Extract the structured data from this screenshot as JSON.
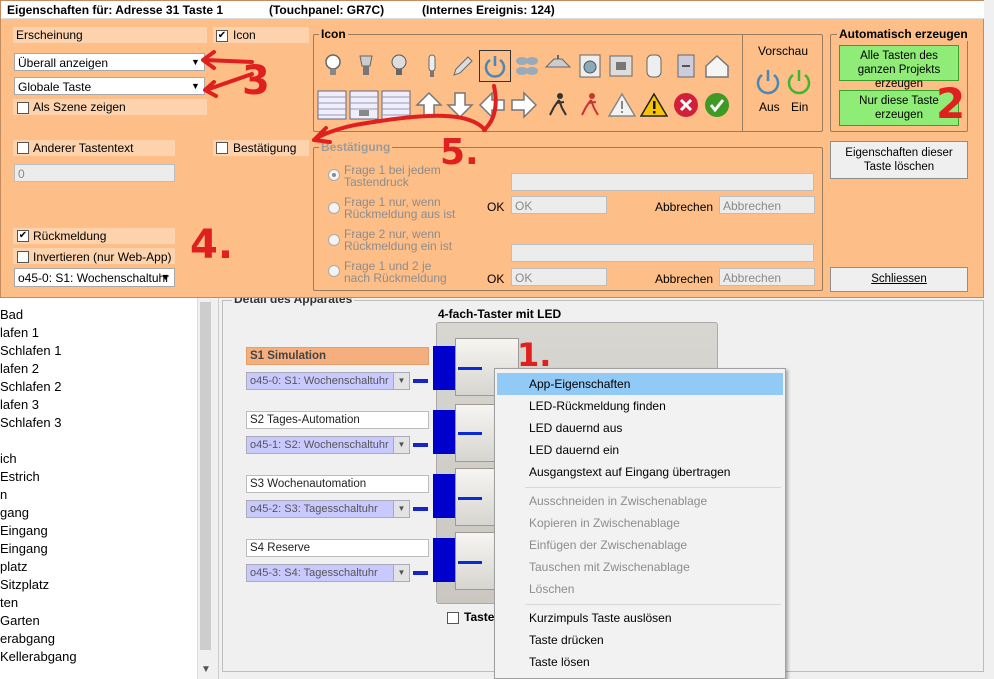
{
  "dialog": {
    "title_left": "Eigenschaften für: Adresse  31  Taste 1",
    "title_mid": "(Touchpanel: GR7C)",
    "title_right": "(Internes Ereignis: 124)",
    "erscheinung_label": "Erscheinung",
    "erscheinung_value": "Überall anzeigen",
    "taste_type_value": "Globale Taste",
    "als_szene_label": "Als Szene zeigen",
    "als_szene_checked": false,
    "icon_chk_label": "Icon",
    "icon_chk_checked": true,
    "anderer_tastentext_label": "Anderer Tastentext",
    "anderer_tastentext_checked": false,
    "anderer_tastentext_value": "0",
    "bestaetigung_chk_label": "Bestätigung",
    "bestaetigung_chk_checked": false,
    "rueckmeldung_label": "Rückmeldung",
    "rueckmeldung_checked": true,
    "invertieren_label": "Invertieren (nur Web-App)",
    "invertieren_checked": false,
    "rueckmeldung_value": "o45-0: S1: Wochenschaltuhr",
    "icon_group_title": "Icon",
    "vorschau_label": "Vorschau",
    "vorschau_aus": "Aus",
    "vorschau_ein": "Ein",
    "auto_group_title": "Automatisch erzeugen",
    "btn_alle_tasten": "Alle Tasten des ganzen Projekts erzeugen",
    "btn_nur_diese": "Nur diese Taste erzeugen",
    "btn_loeschen": "Eigenschaften dieser Taste löschen",
    "btn_schliessen": "Schliessen",
    "bestaetigung_group_title": "Bestätigung",
    "frage1": "Frage 1 bei jedem Tastendruck",
    "frage1_aus": "Frage 1 nur, wenn Rückmeldung aus ist",
    "frage2_ein": "Frage 2 nur, wenn Rückmeldung ein ist",
    "frage12": "Frage 1 und 2 je nach Rückmeldung",
    "ok_label": "OK",
    "ok_value": "OK",
    "abbrechen_label": "Abbrechen",
    "abbrechen_value": "Abbrechen",
    "icons_row1": [
      "bulb-icon",
      "spotlight-icon",
      "bulb-outline-icon",
      "tube-icon",
      "pen-icon",
      "power-icon",
      "fan-icon",
      "ceiling-lamp-icon",
      "washing-machine-icon",
      "coffee-machine-icon",
      "boiler-icon",
      "cabinet-icon",
      "house-icon"
    ],
    "icons_row2": [
      "blind-1-icon",
      "blind-2-icon",
      "blind-3-icon",
      "arrow-up-icon",
      "arrow-down-icon",
      "arrow-left-icon",
      "arrow-right-icon",
      "runner-icon",
      "runner-red-icon",
      "warning-outline-icon",
      "warning-yellow-icon",
      "error-red-icon",
      "ok-green-icon"
    ]
  },
  "rooms": [
    "Bad",
    "lafen 1",
    "Schlafen 1",
    "lafen 2",
    "Schlafen 2",
    "lafen 3",
    "Schlafen 3",
    "",
    "ich",
    "Estrich",
    "n",
    "gang",
    "Eingang",
    "Eingang",
    "platz",
    "Sitzplatz",
    "ten",
    "Garten",
    "erabgang",
    "Kellerabgang"
  ],
  "detail": {
    "frame_title": "Detail des Apparates",
    "device_title": "4-fach-Taster mit LED",
    "keys": [
      {
        "label": "S1 Simulation",
        "combo": "o45-0: S1: Wochenschaltuhr"
      },
      {
        "label": "S2 Tages-Automation",
        "combo": "o45-1: S2: Wochenschaltuhr"
      },
      {
        "label": "S3 Wochenautomation",
        "combo": "o45-2: S3: Tagesschaltuhr"
      },
      {
        "label": "S4 Reserve",
        "combo": "o45-3: S4: Tagesschaltuhr"
      }
    ],
    "taste_label": "Taste"
  },
  "context_menu": {
    "items": [
      {
        "label": "App-Eigenschaften",
        "enabled": true,
        "highlighted": true
      },
      {
        "label": "LED-Rückmeldung finden",
        "enabled": true
      },
      {
        "label": "LED dauernd aus",
        "enabled": true
      },
      {
        "label": "LED dauernd ein",
        "enabled": true
      },
      {
        "label": "Ausgangstext auf Eingang übertragen",
        "enabled": true
      },
      {
        "label": "Ausschneiden in Zwischenablage",
        "enabled": false
      },
      {
        "label": "Kopieren in Zwischenablage",
        "enabled": false
      },
      {
        "label": "Einfügen der Zwischenablage",
        "enabled": false
      },
      {
        "label": "Tauschen mit Zwischenablage",
        "enabled": false
      },
      {
        "label": "Löschen",
        "enabled": false
      },
      {
        "label": "Kurzimpuls Taste auslösen",
        "enabled": true
      },
      {
        "label": "Taste drücken",
        "enabled": true
      },
      {
        "label": "Taste lösen",
        "enabled": true
      }
    ]
  },
  "annotations": [
    "1.",
    "2",
    "3",
    "4.",
    "5."
  ],
  "colors": {
    "dialog_bg": "#fdbe88",
    "highlight": "#91c9f7",
    "green_button": "#8fec76",
    "annotation_red": "#e0201e"
  }
}
